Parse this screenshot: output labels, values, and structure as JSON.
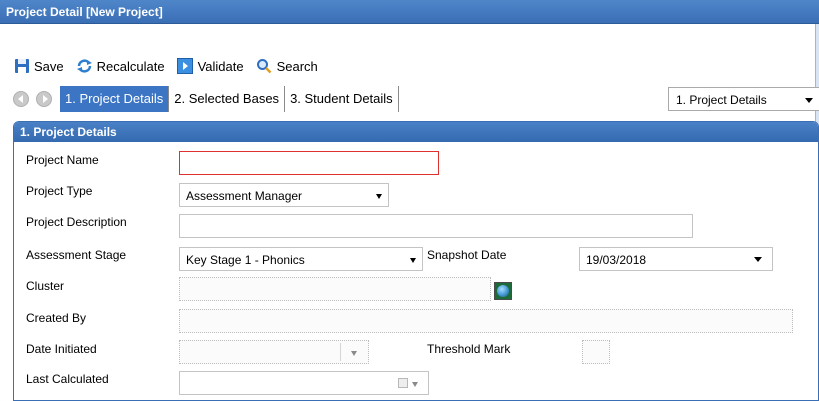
{
  "window": {
    "title": "Project Detail [New Project]"
  },
  "toolbar": {
    "save_label": "Save",
    "recalculate_label": "Recalculate",
    "validate_label": "Validate",
    "search_label": "Search"
  },
  "tabs": [
    {
      "label": "1. Project Details",
      "active": true
    },
    {
      "label": "2. Selected Bases",
      "active": false
    },
    {
      "label": "3. Student Details",
      "active": false
    }
  ],
  "page_select": {
    "value": "1. Project Details"
  },
  "panel": {
    "title": "1. Project Details",
    "labels": {
      "project_name": "Project Name",
      "project_type": "Project Type",
      "project_description": "Project Description",
      "assessment_stage": "Assessment Stage",
      "snapshot_date": "Snapshot Date",
      "cluster": "Cluster",
      "created_by": "Created By",
      "date_initiated": "Date Initiated",
      "threshold_mark": "Threshold Mark",
      "last_calculated": "Last Calculated"
    },
    "values": {
      "project_name": "",
      "project_type": "Assessment Manager",
      "project_description": "",
      "assessment_stage": "Key Stage 1 - Phonics",
      "snapshot_date": "19/03/2018",
      "cluster": "",
      "created_by": "",
      "date_initiated": "",
      "threshold_mark": "",
      "last_calculated": ""
    }
  },
  "colors": {
    "accent": "#3b75c4",
    "required_border": "#e03030"
  }
}
